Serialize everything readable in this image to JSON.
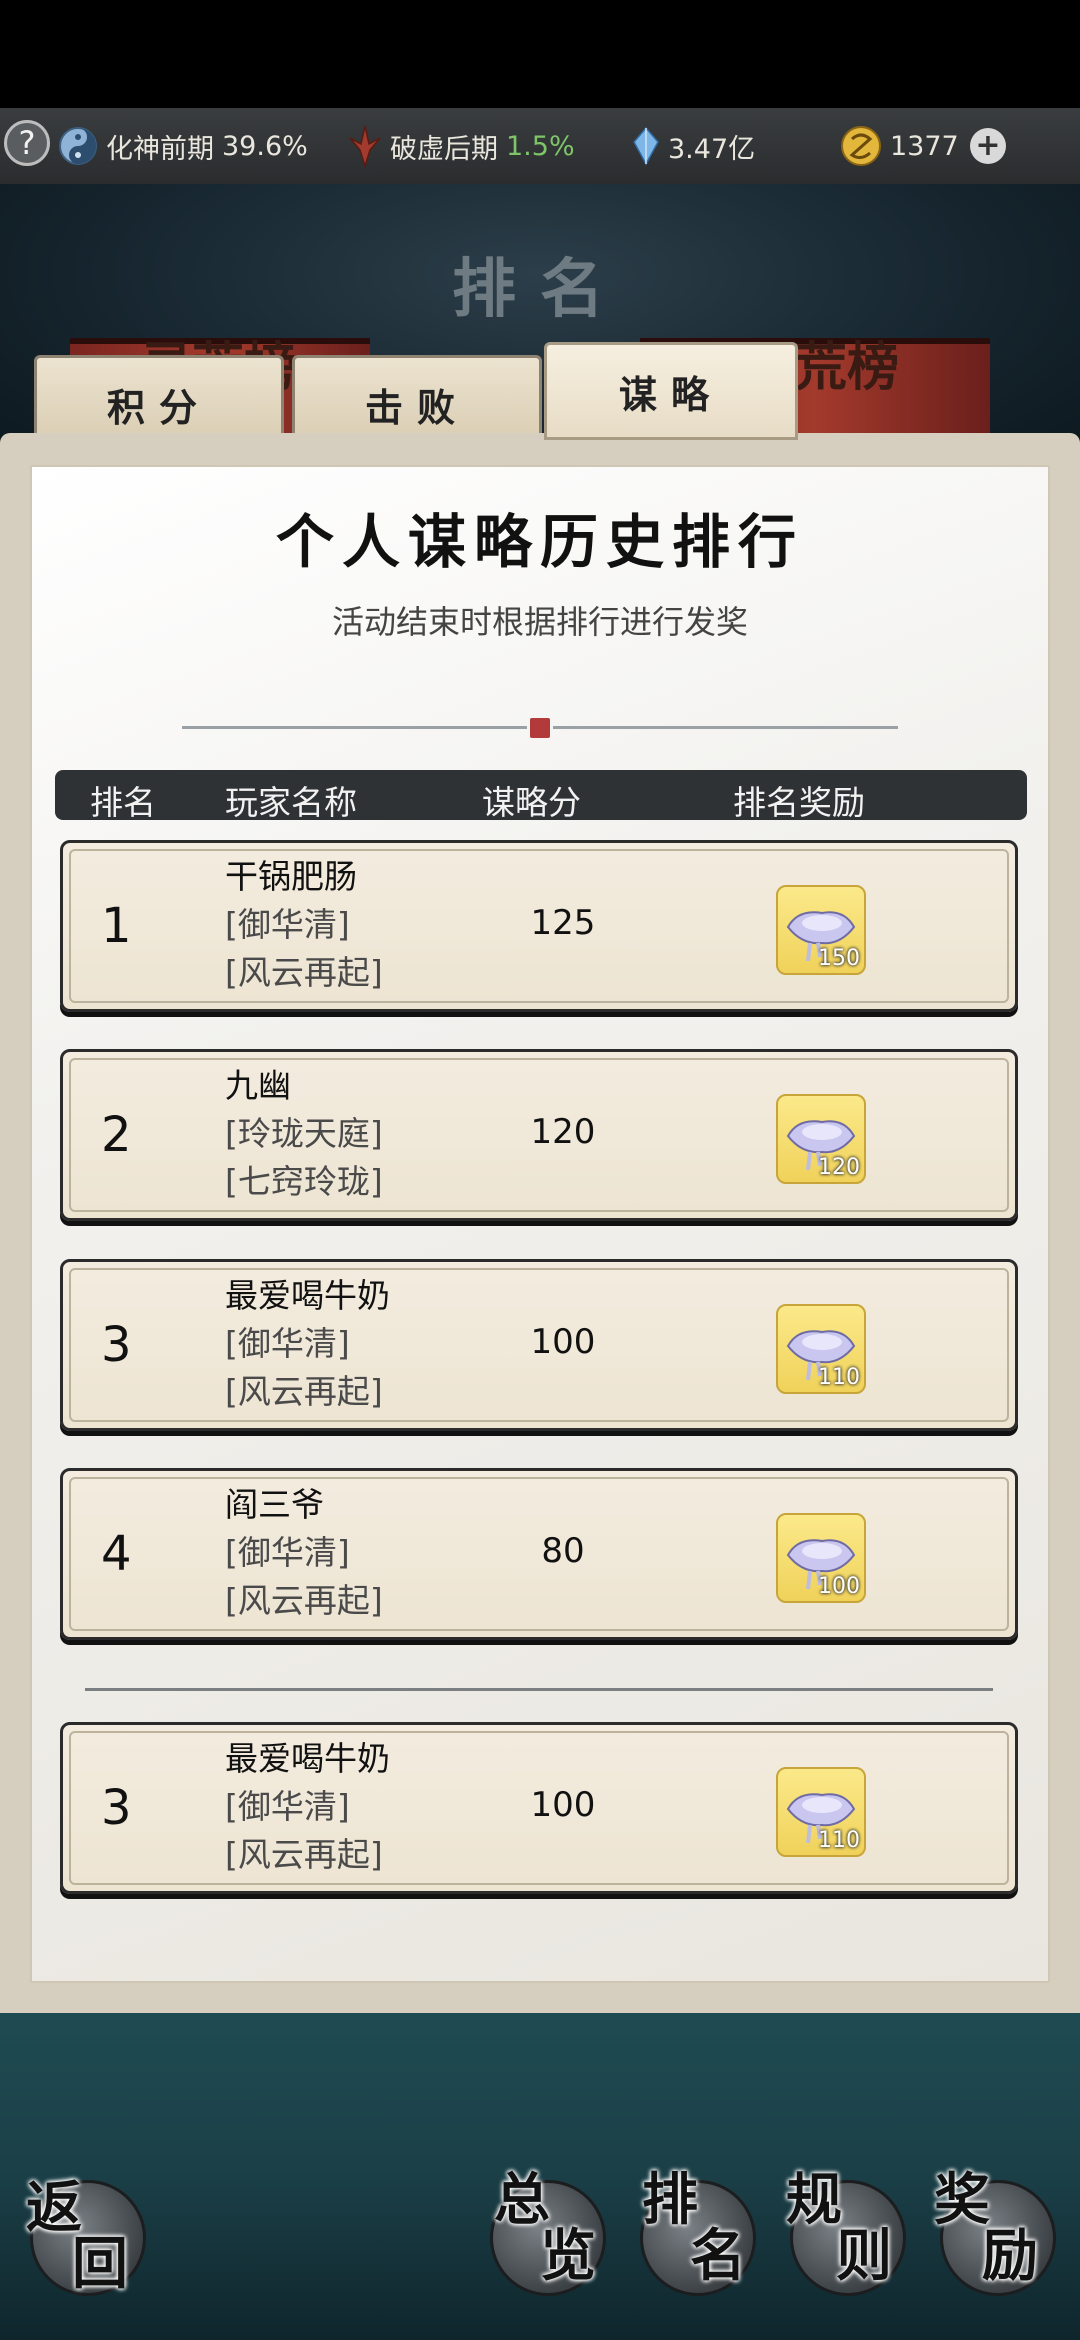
{
  "status_bar": {
    "help": "?",
    "realm1": {
      "label": "化神前期",
      "value": "39.6%"
    },
    "realm2": {
      "label": "破虚后期",
      "value": "1.5%"
    },
    "crystal": "3.47亿",
    "coins": "1377",
    "plus": "+"
  },
  "page": {
    "title": "排名",
    "banner_left": "灵荒榜",
    "banner_right": "荒榜"
  },
  "tabs": [
    {
      "label": "积分",
      "active": false
    },
    {
      "label": "击败",
      "active": false
    },
    {
      "label": "谋略",
      "active": true
    }
  ],
  "panel": {
    "title": "个人谋略历史排行",
    "subtitle": "活动结束时根据排行进行发奖"
  },
  "table": {
    "headers": [
      "排名",
      "玩家名称",
      "谋略分",
      "排名奖励"
    ],
    "rows": [
      {
        "rank": "1",
        "name": "干锅肥肠",
        "guild": "[御华清]",
        "server": "[风云再起]",
        "score": "125",
        "reward": "150"
      },
      {
        "rank": "2",
        "name": "九幽",
        "guild": "[玲珑天庭]",
        "server": "[七窍玲珑]",
        "score": "120",
        "reward": "120"
      },
      {
        "rank": "3",
        "name": "最爱喝牛奶",
        "guild": "[御华清]",
        "server": "[风云再起]",
        "score": "100",
        "reward": "110"
      },
      {
        "rank": "4",
        "name": "阎三爷",
        "guild": "[御华清]",
        "server": "[风云再起]",
        "score": "80",
        "reward": "100"
      }
    ],
    "self_row": {
      "rank": "3",
      "name": "最爱喝牛奶",
      "guild": "[御华清]",
      "server": "[风云再起]",
      "score": "100",
      "reward": "110"
    }
  },
  "bottom_nav": {
    "back": [
      "返",
      "回"
    ],
    "overview": [
      "总",
      "览"
    ],
    "rank": [
      "排",
      "名"
    ],
    "rules": [
      "规",
      "则"
    ],
    "rewards": [
      "奖",
      "励"
    ]
  },
  "colors": {
    "accent_green": "#7ec56a",
    "reward_gold": "#f0d25a",
    "banner_red": "#a33a2c"
  }
}
